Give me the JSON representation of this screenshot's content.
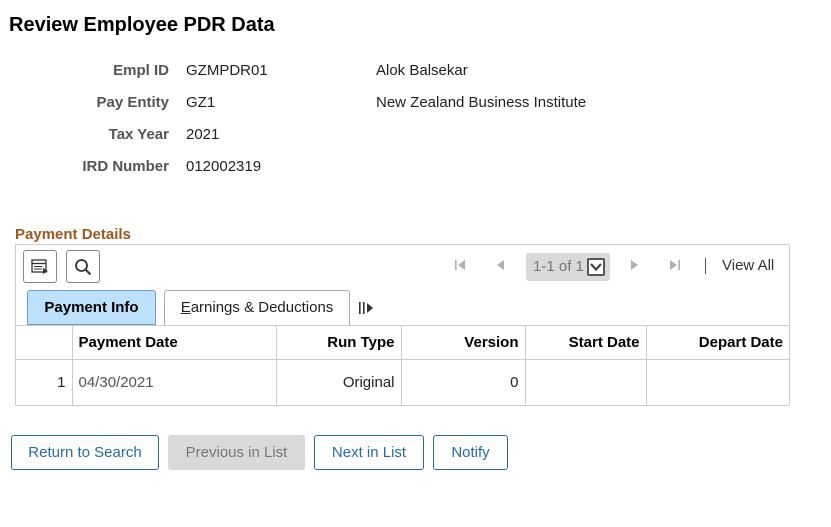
{
  "page": {
    "title": "Review Employee PDR Data"
  },
  "fields": [
    {
      "label": "Empl ID",
      "value": "GZMPDR01",
      "desc": "Alok Balsekar"
    },
    {
      "label": "Pay Entity",
      "value": "GZ1",
      "desc": "New Zealand Business Institute"
    },
    {
      "label": "Tax Year",
      "value": "2021",
      "desc": ""
    },
    {
      "label": "IRD Number",
      "value": "012002319",
      "desc": ""
    }
  ],
  "section": {
    "title": "Payment Details"
  },
  "grid": {
    "pager_text": "1-1 of 1",
    "view_all": "View All",
    "tabs": [
      {
        "label": "Payment Info",
        "active": true
      },
      {
        "label_first": "E",
        "label_rest": "arnings & Deductions",
        "active": false
      }
    ],
    "columns": [
      "",
      "Payment Date",
      "Run Type",
      "Version",
      "Start Date",
      "Depart Date"
    ],
    "rows": [
      {
        "num": "1",
        "payment_date": "04/30/2021",
        "run_type": "Original",
        "version": "0",
        "start_date": "",
        "depart_date": ""
      }
    ]
  },
  "buttons": {
    "return_to_search": "Return to Search",
    "previous_in_list": "Previous in List",
    "next_in_list": "Next in List",
    "notify": "Notify"
  },
  "colors": {
    "section_title": "#A0571E",
    "active_tab": "#bde0fb",
    "link_button": "#2a6aa8",
    "disabled_button": "#d9d9d9"
  },
  "icons": [
    "personalize-grid-icon",
    "search-icon",
    "first-page-icon",
    "previous-page-icon",
    "chevron-down-icon",
    "next-page-icon",
    "last-page-icon",
    "show-all-columns-icon"
  ]
}
